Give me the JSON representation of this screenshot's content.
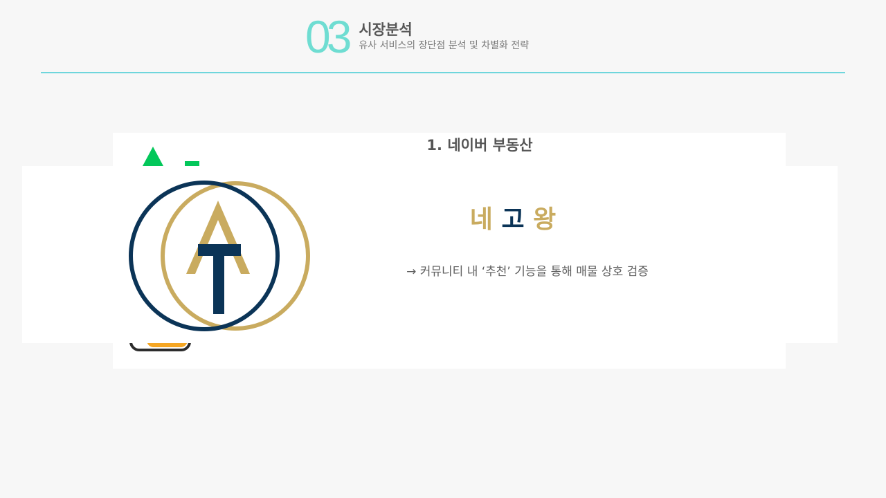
{
  "header": {
    "number": "03",
    "title": "시장분석",
    "subtitle": "유사 서비스의 장단점 분석 및 차별화 전략"
  },
  "card": {
    "title": "1. 네이버 부동산"
  },
  "brand": {
    "name_part1": "네",
    "name_part2": "고",
    "name_part3": "왕",
    "description": "→ 커뮤니티 내 ‘추천’ 기능을 통해 매물 상호 검증"
  },
  "icons": {
    "naver_logo": "naver-real-estate-logo",
    "brand_logo": "at-monogram-logo",
    "badge": "orange-badge"
  },
  "colors": {
    "accent_teal": "#6fddd2",
    "rule": "#6fd6dc",
    "naver_green": "#03c75a",
    "brand_gold": "#c9ab5f",
    "brand_navy": "#0b3457",
    "badge_orange": "#f5a623"
  }
}
